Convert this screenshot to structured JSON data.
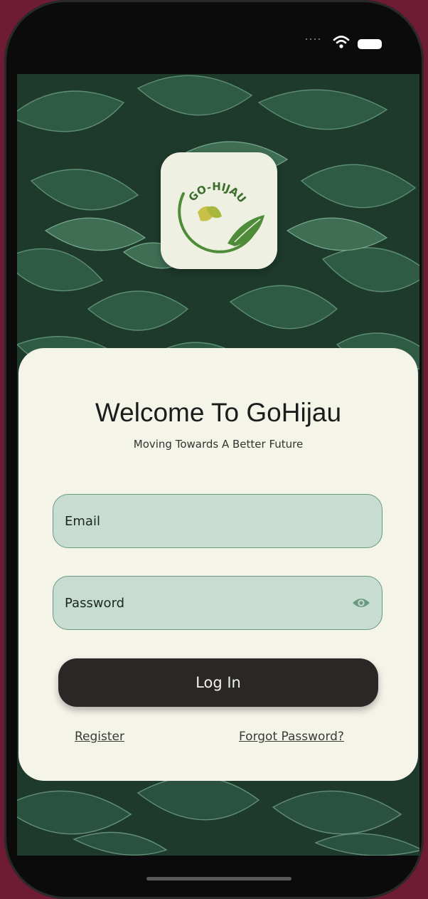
{
  "status_bar": {
    "icons": [
      "signal-dots-icon",
      "wifi-icon",
      "battery-icon"
    ]
  },
  "logo": {
    "text": "GO-HIJAU"
  },
  "welcome": {
    "title": "Welcome To GoHijau",
    "subtitle": "Moving Towards A Better Future"
  },
  "form": {
    "email_placeholder": "Email",
    "email_value": "",
    "password_placeholder": "Password",
    "password_value": "",
    "password_toggle_icon": "eye-icon",
    "login_label": "Log In"
  },
  "links": {
    "register": "Register",
    "forgot_password": "Forgot Password?"
  },
  "colors": {
    "background": "#6d1c33",
    "card": "#f4f4e9",
    "input_fill": "#c7ddd2",
    "input_border": "#6a9981",
    "button": "#2a2727",
    "logo_tile": "#eef0e2",
    "leaf_green": "#4f8c3a"
  }
}
